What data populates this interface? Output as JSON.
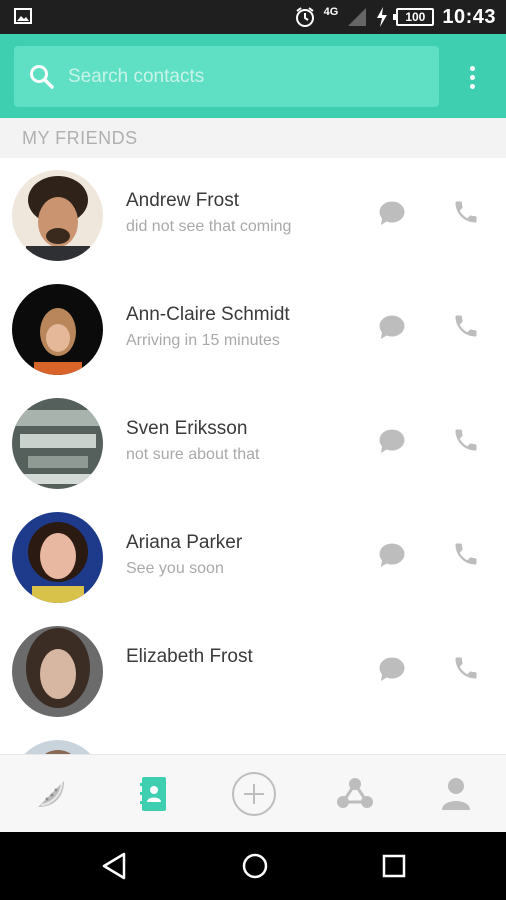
{
  "status_bar": {
    "network": "4G",
    "battery": "100",
    "time": "10:43"
  },
  "search": {
    "placeholder": "Search contacts"
  },
  "section_label": "MY FRIENDS",
  "contacts": [
    {
      "name": "Andrew Frost",
      "status": "did not see that coming"
    },
    {
      "name": "Ann-Claire Schmidt",
      "status": "Arriving in 15 minutes"
    },
    {
      "name": "Sven Eriksson",
      "status": "not sure about that"
    },
    {
      "name": "Ariana Parker",
      "status": "See you soon"
    },
    {
      "name": "Elizabeth Frost",
      "status": ""
    }
  ],
  "bottom_nav": [
    "watermelon-icon",
    "contacts-book-icon",
    "add-circle-icon",
    "group-icon",
    "profile-icon"
  ],
  "colors": {
    "accent": "#3dcfb0",
    "search_bg": "#5fe0c4",
    "icon_grey": "#bdbdbd"
  }
}
